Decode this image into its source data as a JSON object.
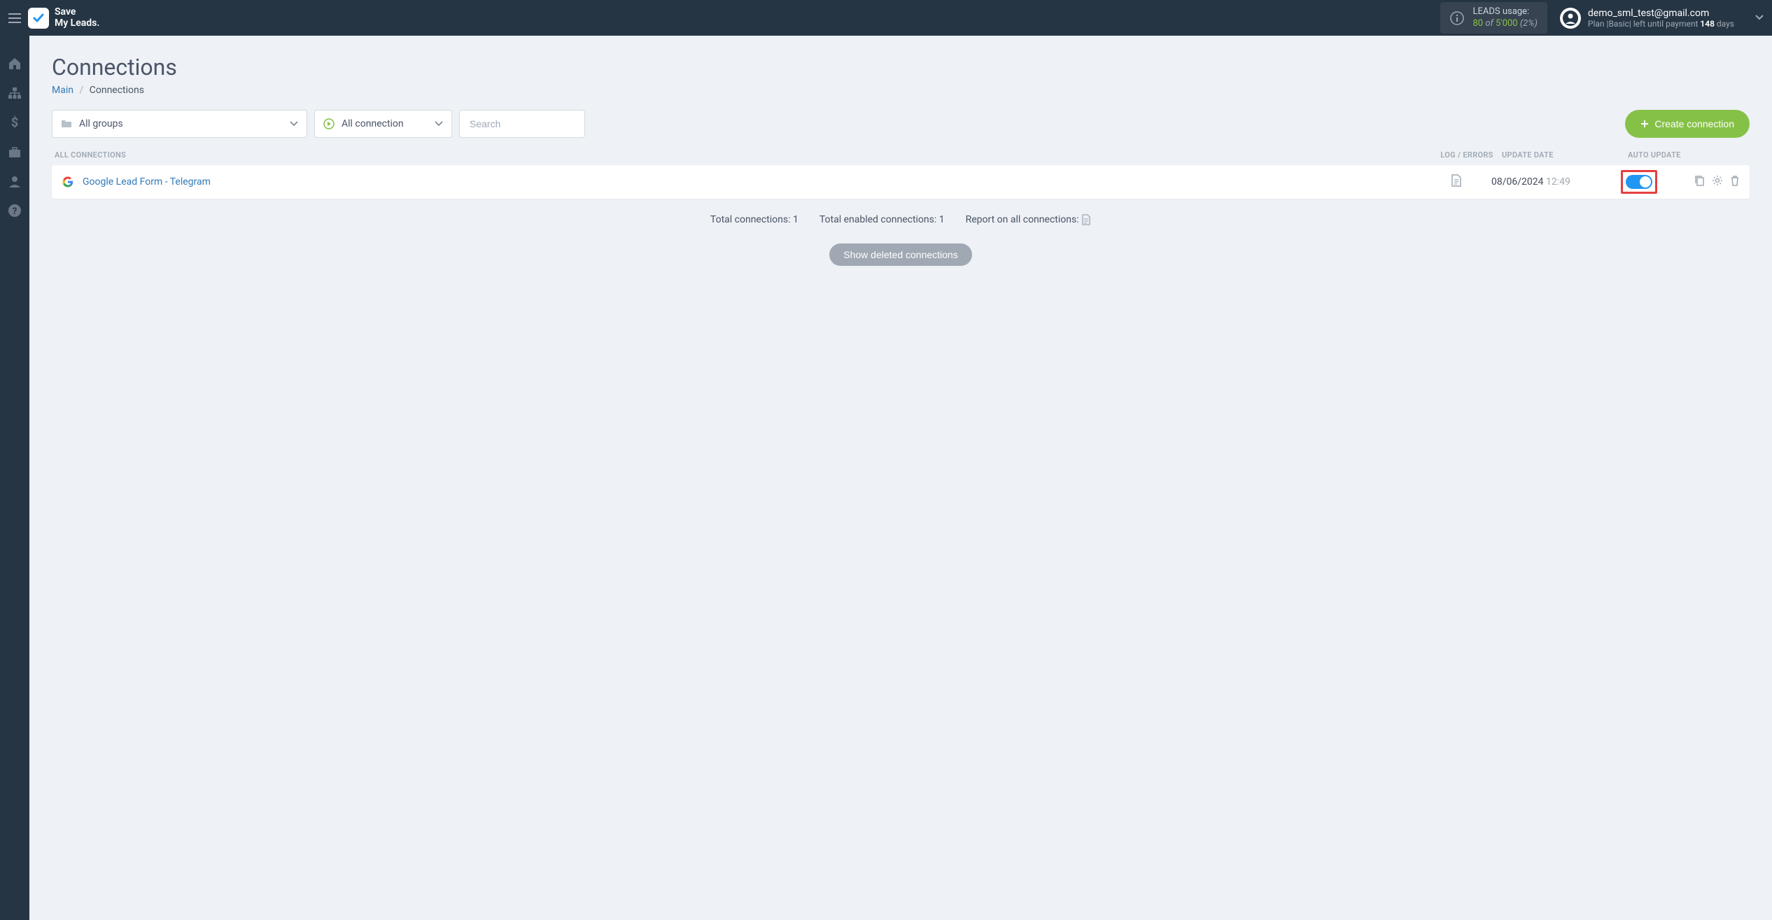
{
  "brand": {
    "line1": "Save",
    "line2": "My Leads."
  },
  "usage": {
    "label": "LEADS usage:",
    "used": "80",
    "of": "of",
    "total": "5'000",
    "pct": "(2%)"
  },
  "user": {
    "email": "demo_sml_test@gmail.com",
    "plan_prefix": "Plan |",
    "plan_name": "Basic",
    "plan_mid": "| left until payment ",
    "days": "148",
    "days_suffix": " days"
  },
  "page": {
    "title": "Connections",
    "breadcrumb_main": "Main",
    "breadcrumb_current": "Connections"
  },
  "filters": {
    "groups": "All groups",
    "connection": "All connection",
    "search_placeholder": "Search",
    "create_label": "Create connection"
  },
  "table_headers": {
    "all": "ALL CONNECTIONS",
    "log": "LOG / ERRORS",
    "date": "UPDATE DATE",
    "auto": "AUTO UPDATE"
  },
  "rows": [
    {
      "name": "Google Lead Form - Telegram",
      "date": "08/06/2024",
      "time": "12:49"
    }
  ],
  "summary": {
    "total_label": "Total connections: ",
    "total_value": "1",
    "enabled_label": "Total enabled connections: ",
    "enabled_value": "1",
    "report_label": "Report on all connections: "
  },
  "show_deleted": "Show deleted connections"
}
